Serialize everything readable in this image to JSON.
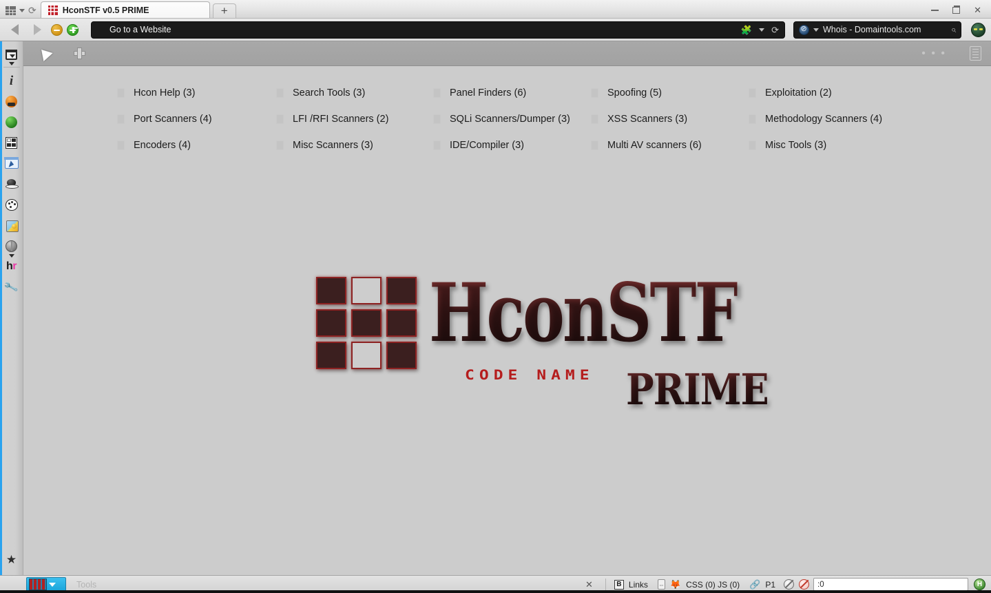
{
  "window": {
    "title_bar": {
      "app_menu_icon": "grid-icon",
      "app_menu_caret": "chevron-down-icon",
      "sync_icon": "sync-icon",
      "tabs": [
        {
          "favicon": "hconstf-favicon",
          "label": "HconSTF v0.5 PRIME",
          "active": true
        }
      ],
      "new_tab_label": "+",
      "controls": {
        "minimize": "minimize-icon",
        "maximize": "restore-icon",
        "close": "✕"
      }
    },
    "nav_bar": {
      "back_icon": "back-arrow-icon",
      "forward_icon": "forward-arrow-icon",
      "zoom_out_icon": "minus-circle-icon",
      "zoom_in_icon": "plus-circle-icon",
      "url_placeholder": "Go to a Website",
      "url_value": "",
      "addon_icon": "puzzle-piece-icon",
      "addon_caret": "chevron-down-icon",
      "reload_icon": "reload-icon",
      "search": {
        "engine_icon": "search-engine-icon",
        "engine_caret": "chevron-down-icon",
        "value": "Whois - Domaintools.com",
        "go_icon": "magnifier-icon"
      },
      "profile_icon": "avatar-icon"
    },
    "toolbar": {
      "cursor_label": "arrow-tool",
      "add_label": "add-tool",
      "overflow_label": "• • •",
      "reader_label": "reader-view"
    },
    "sidebar": {
      "items": [
        {
          "name": "panel-switcher",
          "icon": "panel-dropdown-icon"
        },
        {
          "name": "info",
          "icon": "info-icon"
        },
        {
          "name": "hat-orange",
          "icon": "orange-ball-icon"
        },
        {
          "name": "green-ball",
          "icon": "green-ball-icon"
        },
        {
          "name": "grid-tools",
          "icon": "grid-tiles-icon"
        },
        {
          "name": "select-tool",
          "icon": "select-region-icon"
        },
        {
          "name": "black-hat",
          "icon": "top-hat-icon"
        },
        {
          "name": "palette",
          "icon": "palette-icon"
        },
        {
          "name": "lab-flask",
          "icon": "lab-flask-icon"
        },
        {
          "name": "globe",
          "icon": "globe-icon"
        },
        {
          "name": "hackery",
          "icon": "hr-text-icon",
          "text_a": "h",
          "text_b": "r"
        },
        {
          "name": "wrench",
          "icon": "wrench-icon"
        }
      ],
      "bookmark_star": "★"
    },
    "status_bar": {
      "tools_button_label": "tools-menu",
      "tools_text": "Tools",
      "close_label": "✕",
      "b_badge": "B",
      "links_label": "Links",
      "resize_icon": "resize-icon",
      "firefox_icon": "fox-icon",
      "css_js_label": "CSS (0) JS (0)",
      "chain_icon": "chain-icon",
      "page_label": "P1",
      "noscript_icon": "noscript-icon",
      "adblock_icon": "adblock-icon",
      "input_value": ":0",
      "badge_letter": "H"
    }
  },
  "page": {
    "menu_items": [
      {
        "label": "Hcon Help (3)"
      },
      {
        "label": "Search Tools (3)"
      },
      {
        "label": "Panel Finders (6)"
      },
      {
        "label": "Spoofing (5)"
      },
      {
        "label": "Exploitation (2)"
      },
      {
        "label": "Port Scanners (4)"
      },
      {
        "label": "LFI /RFI Scanners (2)"
      },
      {
        "label": "SQLi Scanners/Dumper (3)"
      },
      {
        "label": "XSS Scanners (3)"
      },
      {
        "label": "Methodology Scanners (4)"
      },
      {
        "label": "Encoders (4)"
      },
      {
        "label": "Misc Scanners (3)"
      },
      {
        "label": "IDE/Compiler (3)"
      },
      {
        "label": "Multi AV scanners (6)"
      },
      {
        "label": "Misc Tools (3)"
      }
    ],
    "logo": {
      "main_text": "HconSTF",
      "sub_text": "CODE NAME",
      "prime_text": "PRIME",
      "grid_cells": [
        "solid",
        "hollow",
        "solid",
        "solid",
        "solid",
        "solid",
        "solid",
        "hollow",
        "solid"
      ]
    }
  },
  "colors": {
    "page_background": "#cccccc",
    "toolbar_gray": "#a8a8a8",
    "url_bar": "#1b1b1b",
    "accent_blue": "#2aa3ef",
    "logo_red": "#b51d1d",
    "logo_dark": "#3b1f1f"
  }
}
